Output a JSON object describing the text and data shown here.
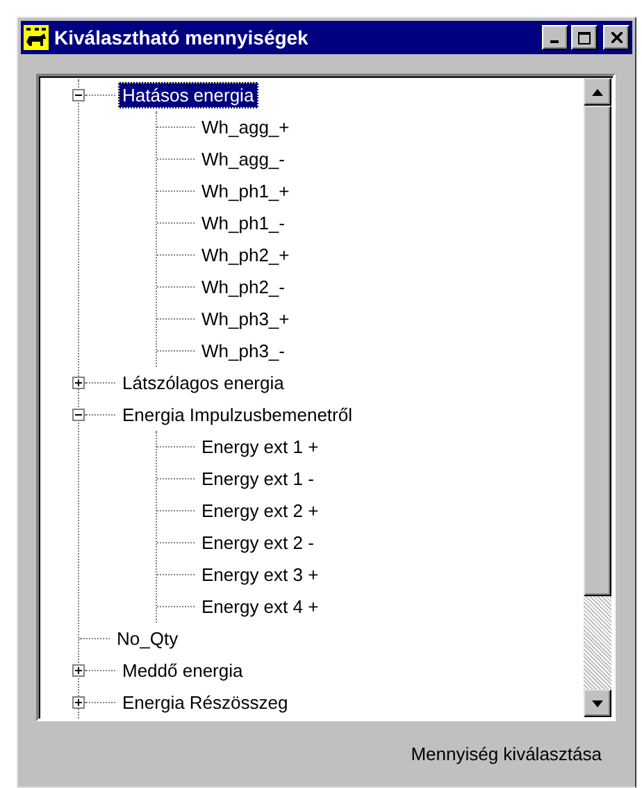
{
  "window": {
    "title": "Kiválasztható mennyiségek"
  },
  "tree": [
    {
      "label": "Hatásos energia",
      "selected": true,
      "expanded": true,
      "children": [
        {
          "label": "Wh_agg_+",
          "selected": false
        },
        {
          "label": "Wh_agg_-",
          "selected": false
        },
        {
          "label": "Wh_ph1_+",
          "selected": false
        },
        {
          "label": "Wh_ph1_-",
          "selected": false
        },
        {
          "label": "Wh_ph2_+",
          "selected": false
        },
        {
          "label": "Wh_ph2_-",
          "selected": false
        },
        {
          "label": "Wh_ph3_+",
          "selected": false
        },
        {
          "label": "Wh_ph3_-",
          "selected": false
        }
      ]
    },
    {
      "label": "Látszólagos energia",
      "selected": false,
      "expanded": false
    },
    {
      "label": "Energia Impulzusbemenetről",
      "selected": false,
      "expanded": true,
      "children": [
        {
          "label": "Energy ext 1 +",
          "selected": false
        },
        {
          "label": "Energy ext 1 -",
          "selected": false
        },
        {
          "label": "Energy ext 2 +",
          "selected": false
        },
        {
          "label": "Energy ext 2 -",
          "selected": false
        },
        {
          "label": "Energy ext 3 +",
          "selected": false
        },
        {
          "label": "Energy ext 4 +",
          "selected": false
        }
      ]
    },
    {
      "label": "No_Qty",
      "selected": false
    },
    {
      "label": "Meddő energia",
      "selected": false,
      "expanded": false
    },
    {
      "label": "Energia Részösszeg",
      "selected": false,
      "expanded": false
    }
  ],
  "status_label": "Mennyiség kiválasztása"
}
